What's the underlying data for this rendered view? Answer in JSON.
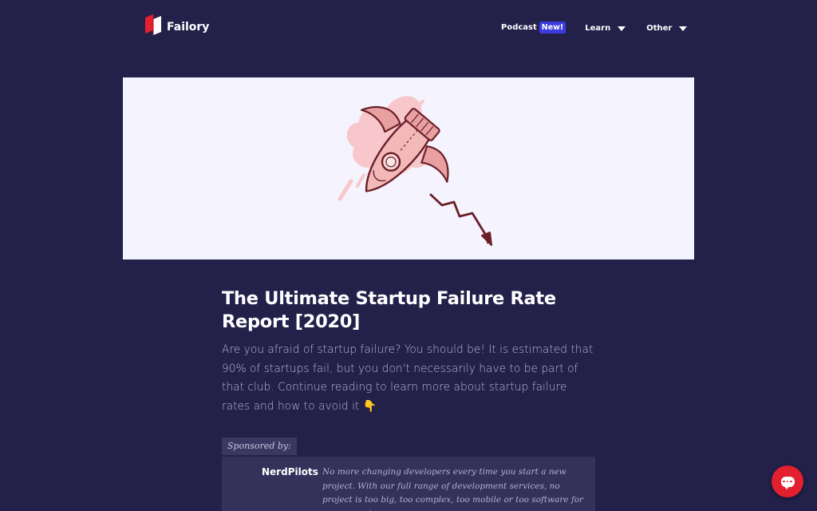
{
  "nav": {
    "logo_text": "Failory",
    "podcast_label": "Podcast",
    "podcast_badge": "New!",
    "learn_label": "Learn",
    "other_label": "Other"
  },
  "article": {
    "title": "The Ultimate Startup Failure Rate Report [2020]",
    "lead": "Are you afraid of startup failure? You should be! It is estimated that 90% of startups fail, but you don't necessarily have to be part of that club. Continue reading to learn more about startup failure rates and how to avoid it",
    "lead_emoji": "👇"
  },
  "sponsor": {
    "tag": "Sponsored by:",
    "name": "NerdPilots",
    "description": "No more changing developers every time you start a new project. With our full range of development services, no project is too big, too complex, too mobile or too software for us to complete."
  },
  "colors": {
    "background": "#23204a",
    "brand_red": "#e2202f",
    "badge_blue": "#3b3be0"
  }
}
